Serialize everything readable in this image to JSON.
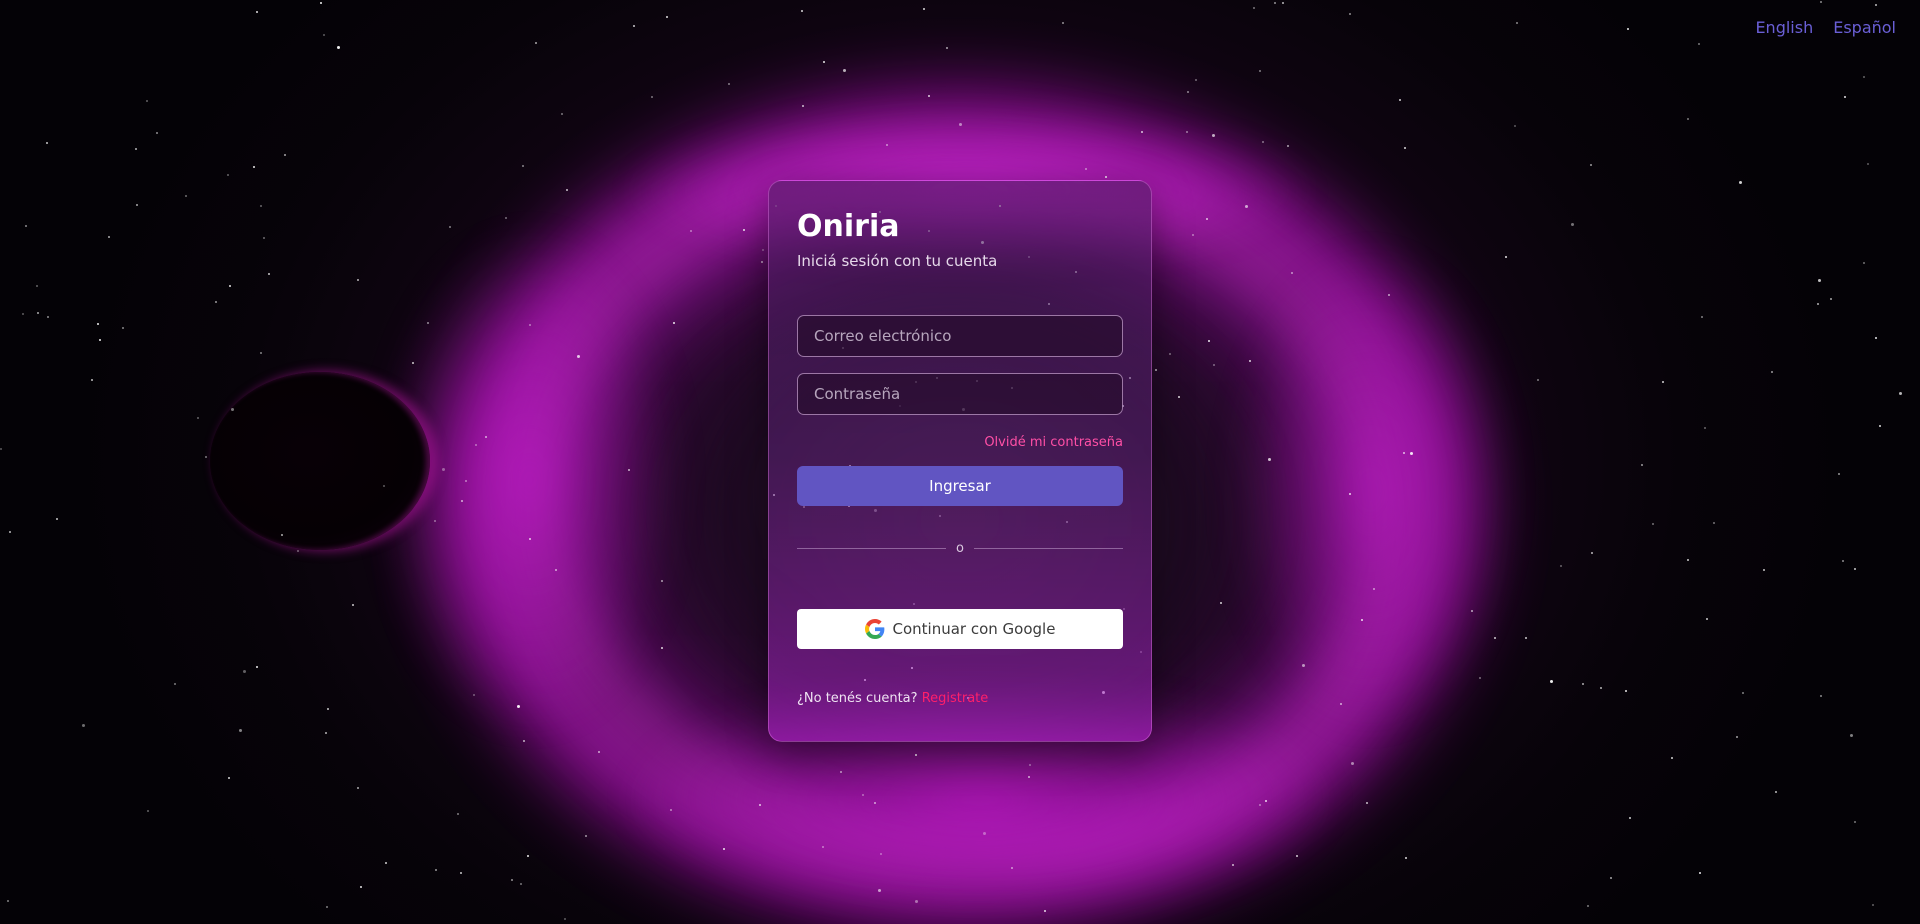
{
  "language_switcher": {
    "english": "English",
    "spanish": "Español"
  },
  "login_card": {
    "title": "Oniria",
    "subtitle": "Iniciá sesión con tu cuenta",
    "email_placeholder": "Correo electrónico",
    "email_value": "",
    "password_placeholder": "Contraseña",
    "password_value": "",
    "forgot_password": "Olvidé mi contraseña",
    "submit_label": "Ingresar",
    "divider_text": "o",
    "google_label": "Continuar con Google",
    "signup_prompt": "¿No tenés cuenta?",
    "signup_link": "Registrate"
  },
  "icons": {
    "google": "google-icon"
  },
  "colors": {
    "accent": "#6155c2",
    "link_pink": "#ff4fa6",
    "signup_red": "#ff1f6a",
    "language_link": "#6a5fd6",
    "nebula": "#e014f0"
  }
}
